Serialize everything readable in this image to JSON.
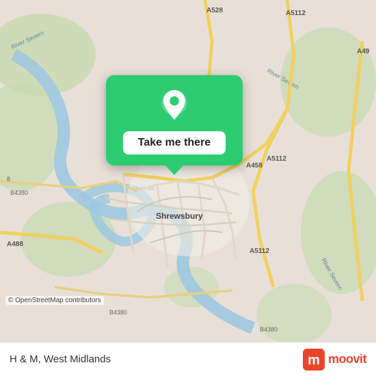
{
  "map": {
    "attribution": "© OpenStreetMap contributors",
    "center": "Shrewsbury"
  },
  "popup": {
    "button_label": "Take me there",
    "pin_icon": "location-pin-icon"
  },
  "bottom_bar": {
    "location_label": "H & M, West Midlands",
    "logo_text": "moovit"
  }
}
